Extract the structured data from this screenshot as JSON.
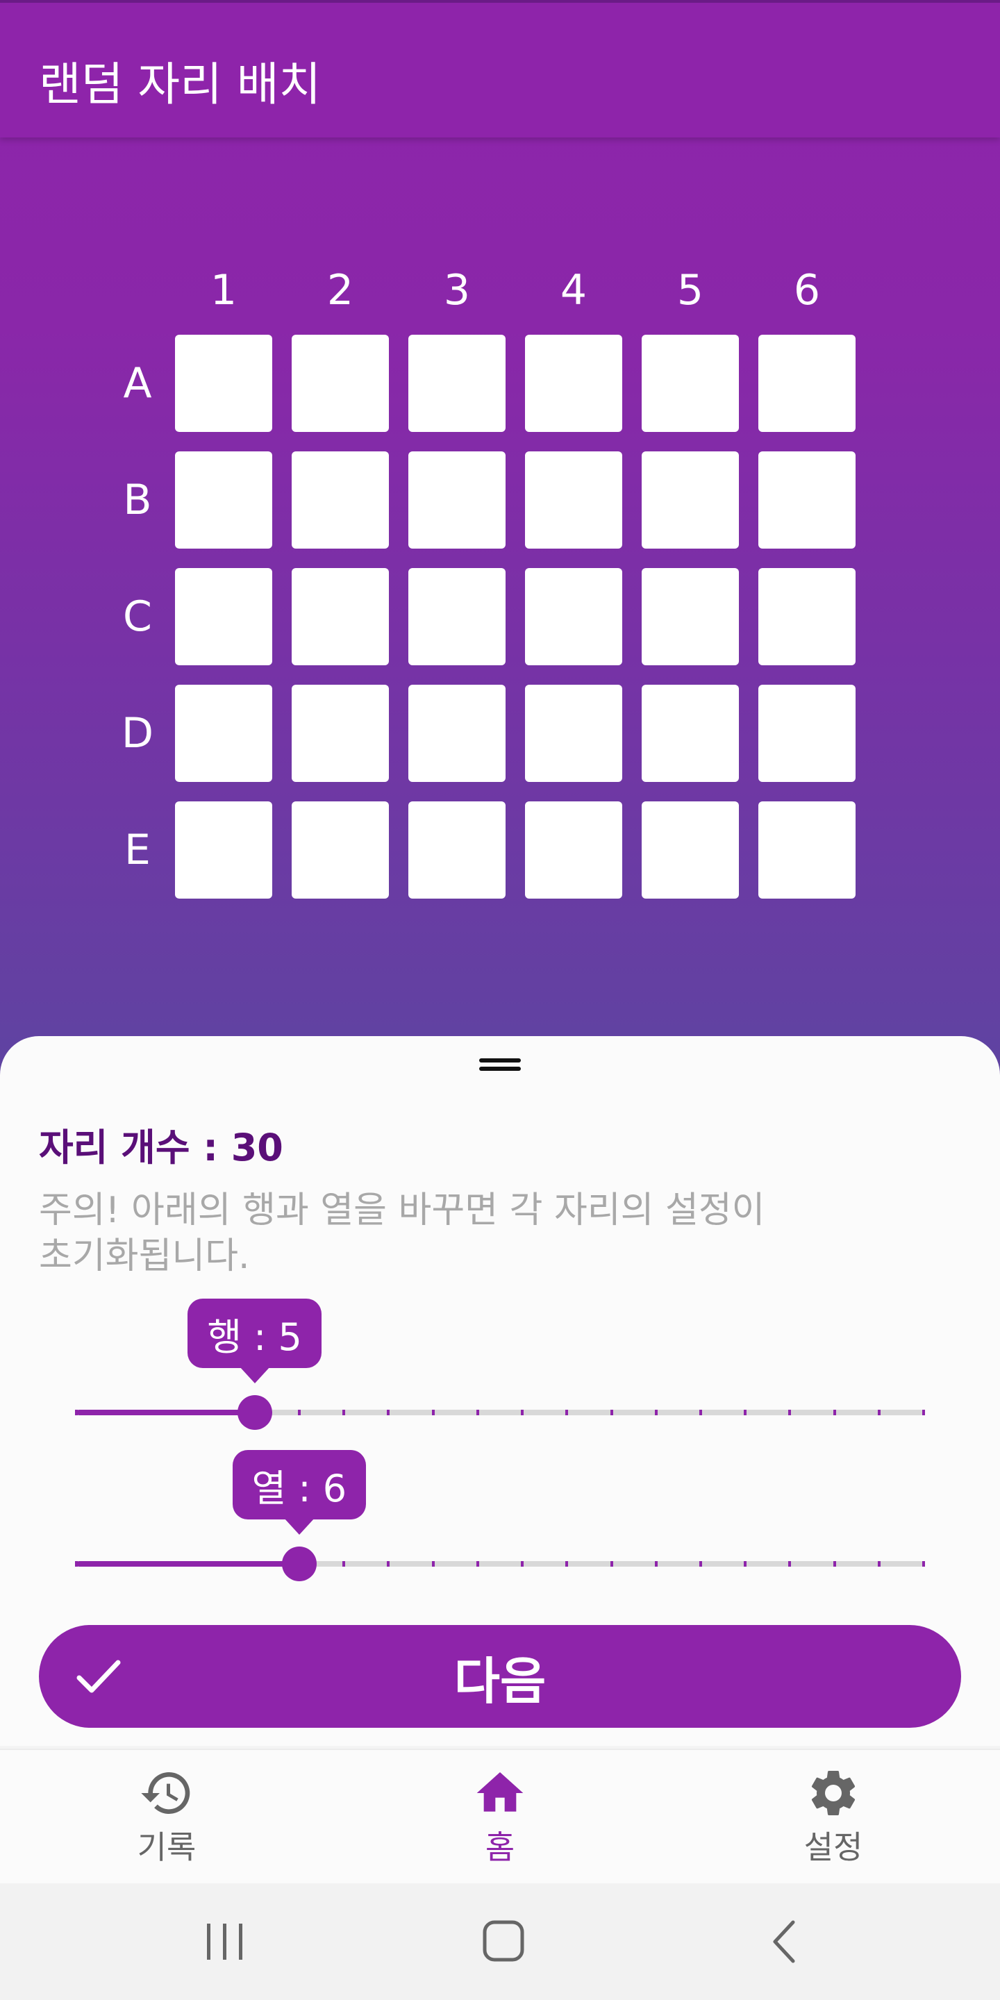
{
  "app_bar": {
    "title": "랜덤 자리 배치"
  },
  "grid": {
    "columns": [
      "1",
      "2",
      "3",
      "4",
      "5",
      "6"
    ],
    "rows": [
      "A",
      "B",
      "C",
      "D",
      "E"
    ]
  },
  "sheet": {
    "seat_count_text": "자리 개수 : 30",
    "warning_line1": "주의! 아래의 행과 열을 바꾸면 각 자리의 설정이",
    "warning_line2": "초기화됩니다.",
    "row_slider": {
      "label": "행 : 5",
      "value": 5,
      "min": 1,
      "max": 20
    },
    "col_slider": {
      "label": "열 : 6",
      "value": 6,
      "min": 1,
      "max": 20
    },
    "next_button": {
      "label": "다음",
      "icon": "check-icon"
    }
  },
  "bottom_nav": {
    "items": [
      {
        "label": "기록",
        "icon": "history-icon",
        "active": false
      },
      {
        "label": "홈",
        "icon": "home-icon",
        "active": true
      },
      {
        "label": "설정",
        "icon": "gear-icon",
        "active": false
      }
    ]
  },
  "colors": {
    "primary": "#8e24aa",
    "gradient_bottom": "#5e44a1",
    "seat_count_text": "#5a0f78",
    "warning_text": "#a8a8a8",
    "inactive_nav": "#666666"
  }
}
